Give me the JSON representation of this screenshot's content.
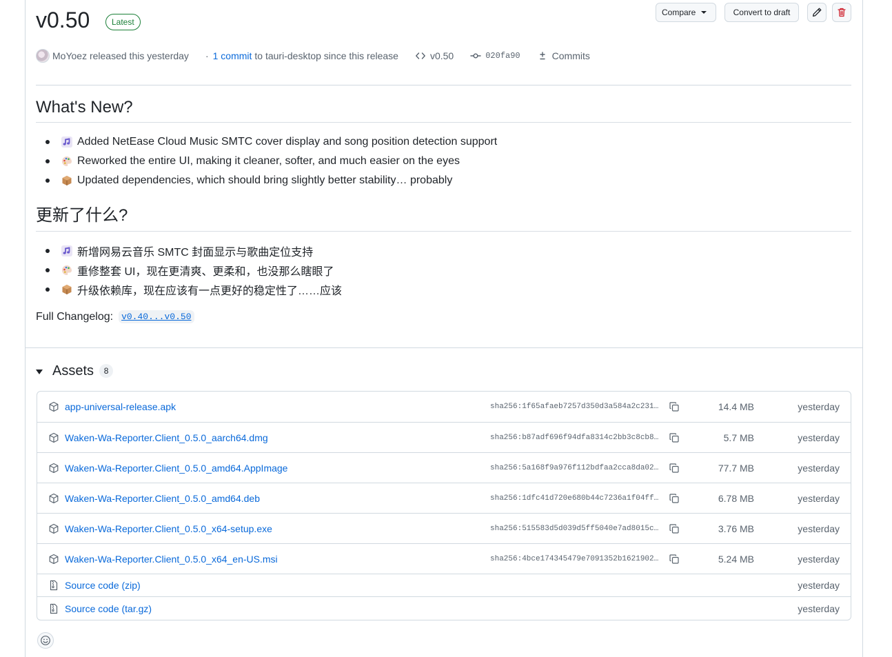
{
  "release": {
    "title": "v0.50",
    "badge": "Latest",
    "actions": {
      "compare_label": "Compare",
      "draft_label": "Convert to draft"
    },
    "meta": {
      "author_text": "MoYoez released this yesterday",
      "separator": "·",
      "commit_count_link": "1 commit",
      "commit_suffix": "to tauri-desktop since this release",
      "tag": "v0.50",
      "commit_hash": "020fa90",
      "commits_label": "Commits"
    }
  },
  "notes": {
    "en_heading": "What's New?",
    "en_items": [
      {
        "icon": "music-note-icon",
        "text": "Added NetEase Cloud Music SMTC cover display and song position detection support"
      },
      {
        "icon": "palette-icon",
        "text": "Reworked the entire UI, making it cleaner, softer, and much easier on the eyes"
      },
      {
        "icon": "package-icon",
        "text": "Updated dependencies, which should bring slightly better stability… probably"
      }
    ],
    "zh_heading": "更新了什么?",
    "zh_items": [
      {
        "icon": "music-note-icon",
        "text": "新增网易云音乐 SMTC 封面显示与歌曲定位支持"
      },
      {
        "icon": "palette-icon",
        "text": "重修整套 UI，现在更清爽、更柔和，也没那么瞎眼了"
      },
      {
        "icon": "package-icon",
        "text": "升级依赖库，现在应该有一点更好的稳定性了……应该"
      }
    ],
    "changelog_label": "Full Changelog:",
    "changelog_link": "v0.40...v0.50"
  },
  "assets": {
    "title": "Assets",
    "count": "8",
    "rows": [
      {
        "name": "app-universal-release.apk",
        "sha": "sha256:1f65afaeb7257d350d3a584a2c231…",
        "size": "14.4 MB",
        "date": "yesterday",
        "icon": "package-icon"
      },
      {
        "name": "Waken-Wa-Reporter.Client_0.5.0_aarch64.dmg",
        "sha": "sha256:b87adf696f94dfa8314c2bb3c8cb8…",
        "size": "5.7 MB",
        "date": "yesterday",
        "icon": "package-icon"
      },
      {
        "name": "Waken-Wa-Reporter.Client_0.5.0_amd64.AppImage",
        "sha": "sha256:5a168f9a976f112bdfaa2cca8da02…",
        "size": "77.7 MB",
        "date": "yesterday",
        "icon": "package-icon"
      },
      {
        "name": "Waken-Wa-Reporter.Client_0.5.0_amd64.deb",
        "sha": "sha256:1dfc41d720e680b44c7236a1f04ff…",
        "size": "6.78 MB",
        "date": "yesterday",
        "icon": "package-icon"
      },
      {
        "name": "Waken-Wa-Reporter.Client_0.5.0_x64-setup.exe",
        "sha": "sha256:515583d5d039d5ff5040e7ad8015c…",
        "size": "3.76 MB",
        "date": "yesterday",
        "icon": "package-icon"
      },
      {
        "name": "Waken-Wa-Reporter.Client_0.5.0_x64_en-US.msi",
        "sha": "sha256:4bce174345479e7091352b1621902…",
        "size": "5.24 MB",
        "date": "yesterday",
        "icon": "package-icon"
      },
      {
        "name": "Source code (zip)",
        "sha": "",
        "size": "",
        "date": "yesterday",
        "icon": "file-zip-icon"
      },
      {
        "name": "Source code (tar.gz)",
        "sha": "",
        "size": "",
        "date": "yesterday",
        "icon": "file-zip-icon"
      }
    ]
  },
  "colors": {
    "link": "#0969da",
    "success": "#1a7f37",
    "danger": "#cf222e",
    "muted": "#59636e",
    "border": "#d1d9e0"
  }
}
